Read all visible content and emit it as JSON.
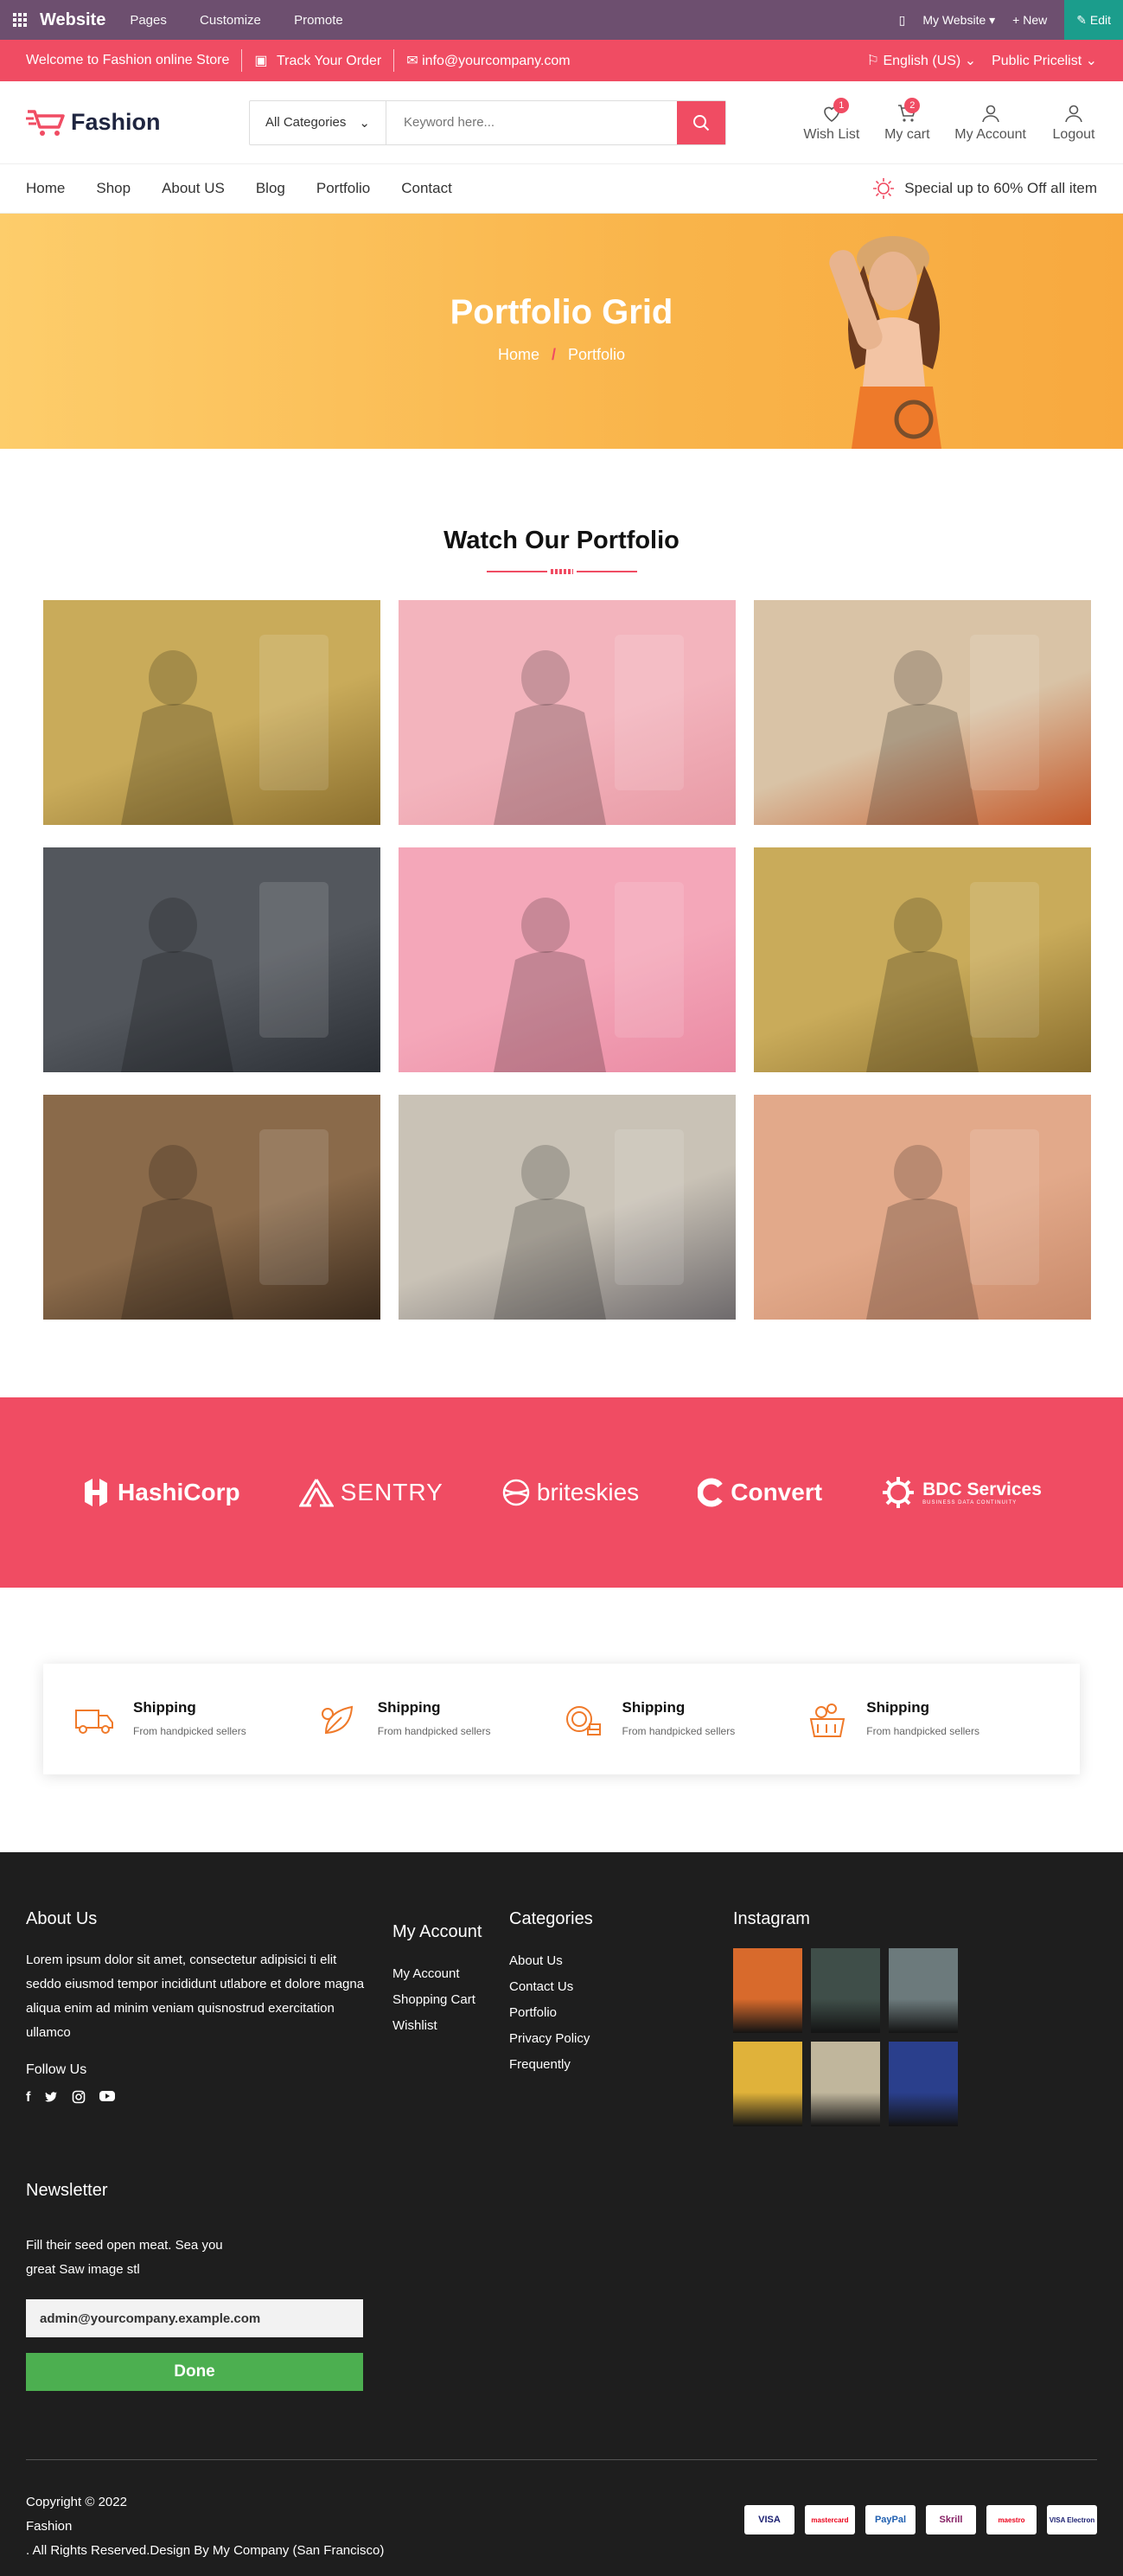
{
  "odoo_bar": {
    "brand": "Website",
    "menu": [
      "Pages",
      "Customize",
      "Promote"
    ],
    "site_switch": "My Website",
    "new_label": "+ New",
    "edit_label": "Edit"
  },
  "top_strip": {
    "welcome": "Welcome to Fashion online Store",
    "track": "Track Your Order",
    "email": "info@yourcompany.com",
    "language": "English (US)",
    "pricelist": "Public Pricelist"
  },
  "header": {
    "logo_text": "Fashion",
    "category_select": "All Categories",
    "search_placeholder": "Keyword here...",
    "icons": [
      {
        "label": "Wish List",
        "badge": "1"
      },
      {
        "label": "My cart",
        "badge": "2"
      },
      {
        "label": "My Account",
        "badge": ""
      },
      {
        "label": "Logout",
        "badge": ""
      }
    ]
  },
  "nav": {
    "items": [
      "Home",
      "Shop",
      "About US",
      "Blog",
      "Portfolio",
      "Contact"
    ],
    "promo": "Special up to 60% Off all item"
  },
  "banner": {
    "title": "Portfolio Grid",
    "crumb_home": "Home",
    "crumb_sep": "/",
    "crumb_current": "Portfolio"
  },
  "portfolio": {
    "heading": "Watch Our Portfolio",
    "tiles": [
      {
        "name": "woman-orange-dress",
        "colors": [
          "#c9ab5a",
          "#8a6e2d"
        ]
      },
      {
        "name": "clothes-rack-pink",
        "colors": [
          "#f3b4bd",
          "#e89aa5"
        ]
      },
      {
        "name": "autumn-flatlay",
        "colors": [
          "#d9c3a6",
          "#c55a2b"
        ]
      },
      {
        "name": "men-leather-bags",
        "colors": [
          "#53575d",
          "#2b2f35"
        ]
      },
      {
        "name": "woman-pink-hat",
        "colors": [
          "#f4a7b9",
          "#ea8aa3"
        ]
      },
      {
        "name": "woman-orange-dress-2",
        "colors": [
          "#c9ab5a",
          "#8a6e2d"
        ]
      },
      {
        "name": "man-shopping-store",
        "colors": [
          "#8a6a4a",
          "#3a2a1c"
        ]
      },
      {
        "name": "mall-escalator",
        "colors": [
          "#c9c2b6",
          "#6e6a6c"
        ]
      },
      {
        "name": "rack-beige-wall",
        "colors": [
          "#e2a98a",
          "#c98a6a"
        ]
      }
    ]
  },
  "clients": [
    "HashiCorp",
    "SENTRY",
    "briteskies",
    "Convert",
    "BDC Services"
  ],
  "clients_sub": "BUSINESS DATA CONTINUITY",
  "features": [
    {
      "title": "Shipping",
      "sub": "From handpicked sellers",
      "icon": "truck-icon"
    },
    {
      "title": "Shipping",
      "sub": "From handpicked sellers",
      "icon": "leaf-icon"
    },
    {
      "title": "Shipping",
      "sub": "From handpicked sellers",
      "icon": "coins-icon"
    },
    {
      "title": "Shipping",
      "sub": "From handpicked sellers",
      "icon": "gift-basket-icon"
    }
  ],
  "footer": {
    "about_title": "About Us",
    "about_text": "Lorem ipsum dolor sit amet, consectetur adipisici ti elit seddo eiusmod tempor incididunt utlabore et dolore magna aliqua enim ad minim veniam quisnostrud exercitation ullamco",
    "follow_title": "Follow Us",
    "account_title": "My Account",
    "account_links": [
      "My Account",
      "Shopping Cart",
      "Wishlist"
    ],
    "categories_title": "Categories",
    "categories_links": [
      "About Us",
      "Contact Us",
      "Portfolio",
      "Privacy Policy",
      "Frequently"
    ],
    "instagram_title": "Instagram",
    "instagram_colors": [
      "#d86a2c",
      "#3f4e49",
      "#6c7a7c",
      "#e0b23a",
      "#c0b69c",
      "#2a3f8c"
    ],
    "newsletter_title": "Newsletter",
    "newsletter_text_1": "Fill their seed open meat. Sea you",
    "newsletter_text_2": "great Saw image stl",
    "newsletter_email": "admin@yourcompany.example.com",
    "newsletter_button": "Done",
    "copy_1": "Copyright © 2022",
    "copy_2": "Fashion",
    "copy_3": ". All Rights Reserved.Design By My Company (San Francisco)",
    "payments": [
      "VISA",
      "mastercard",
      "PayPal",
      "Skrill",
      "maestro",
      "VISA Electron"
    ]
  },
  "colors": {
    "accent": "#f04c63",
    "odoo": "#6d4f6f",
    "banner": "#f9b44a",
    "footer": "#1e1e1e",
    "done": "#4caf50"
  }
}
